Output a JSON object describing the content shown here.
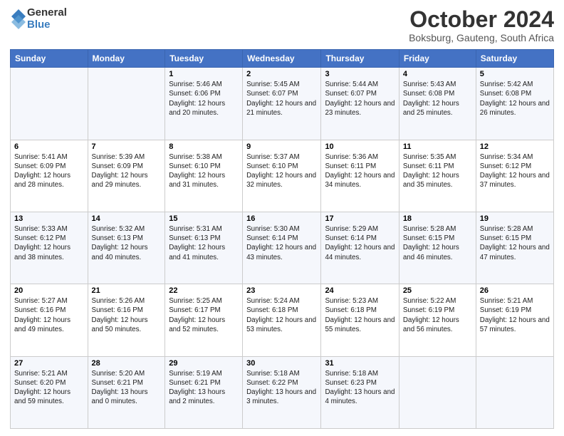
{
  "logo": {
    "general": "General",
    "blue": "Blue"
  },
  "title": "October 2024",
  "subtitle": "Boksburg, Gauteng, South Africa",
  "days_of_week": [
    "Sunday",
    "Monday",
    "Tuesday",
    "Wednesday",
    "Thursday",
    "Friday",
    "Saturday"
  ],
  "weeks": [
    [
      {
        "day": "",
        "sunrise": "",
        "sunset": "",
        "daylight": ""
      },
      {
        "day": "",
        "sunrise": "",
        "sunset": "",
        "daylight": ""
      },
      {
        "day": "1",
        "sunrise": "Sunrise: 5:46 AM",
        "sunset": "Sunset: 6:06 PM",
        "daylight": "Daylight: 12 hours and 20 minutes."
      },
      {
        "day": "2",
        "sunrise": "Sunrise: 5:45 AM",
        "sunset": "Sunset: 6:07 PM",
        "daylight": "Daylight: 12 hours and 21 minutes."
      },
      {
        "day": "3",
        "sunrise": "Sunrise: 5:44 AM",
        "sunset": "Sunset: 6:07 PM",
        "daylight": "Daylight: 12 hours and 23 minutes."
      },
      {
        "day": "4",
        "sunrise": "Sunrise: 5:43 AM",
        "sunset": "Sunset: 6:08 PM",
        "daylight": "Daylight: 12 hours and 25 minutes."
      },
      {
        "day": "5",
        "sunrise": "Sunrise: 5:42 AM",
        "sunset": "Sunset: 6:08 PM",
        "daylight": "Daylight: 12 hours and 26 minutes."
      }
    ],
    [
      {
        "day": "6",
        "sunrise": "Sunrise: 5:41 AM",
        "sunset": "Sunset: 6:09 PM",
        "daylight": "Daylight: 12 hours and 28 minutes."
      },
      {
        "day": "7",
        "sunrise": "Sunrise: 5:39 AM",
        "sunset": "Sunset: 6:09 PM",
        "daylight": "Daylight: 12 hours and 29 minutes."
      },
      {
        "day": "8",
        "sunrise": "Sunrise: 5:38 AM",
        "sunset": "Sunset: 6:10 PM",
        "daylight": "Daylight: 12 hours and 31 minutes."
      },
      {
        "day": "9",
        "sunrise": "Sunrise: 5:37 AM",
        "sunset": "Sunset: 6:10 PM",
        "daylight": "Daylight: 12 hours and 32 minutes."
      },
      {
        "day": "10",
        "sunrise": "Sunrise: 5:36 AM",
        "sunset": "Sunset: 6:11 PM",
        "daylight": "Daylight: 12 hours and 34 minutes."
      },
      {
        "day": "11",
        "sunrise": "Sunrise: 5:35 AM",
        "sunset": "Sunset: 6:11 PM",
        "daylight": "Daylight: 12 hours and 35 minutes."
      },
      {
        "day": "12",
        "sunrise": "Sunrise: 5:34 AM",
        "sunset": "Sunset: 6:12 PM",
        "daylight": "Daylight: 12 hours and 37 minutes."
      }
    ],
    [
      {
        "day": "13",
        "sunrise": "Sunrise: 5:33 AM",
        "sunset": "Sunset: 6:12 PM",
        "daylight": "Daylight: 12 hours and 38 minutes."
      },
      {
        "day": "14",
        "sunrise": "Sunrise: 5:32 AM",
        "sunset": "Sunset: 6:13 PM",
        "daylight": "Daylight: 12 hours and 40 minutes."
      },
      {
        "day": "15",
        "sunrise": "Sunrise: 5:31 AM",
        "sunset": "Sunset: 6:13 PM",
        "daylight": "Daylight: 12 hours and 41 minutes."
      },
      {
        "day": "16",
        "sunrise": "Sunrise: 5:30 AM",
        "sunset": "Sunset: 6:14 PM",
        "daylight": "Daylight: 12 hours and 43 minutes."
      },
      {
        "day": "17",
        "sunrise": "Sunrise: 5:29 AM",
        "sunset": "Sunset: 6:14 PM",
        "daylight": "Daylight: 12 hours and 44 minutes."
      },
      {
        "day": "18",
        "sunrise": "Sunrise: 5:28 AM",
        "sunset": "Sunset: 6:15 PM",
        "daylight": "Daylight: 12 hours and 46 minutes."
      },
      {
        "day": "19",
        "sunrise": "Sunrise: 5:28 AM",
        "sunset": "Sunset: 6:15 PM",
        "daylight": "Daylight: 12 hours and 47 minutes."
      }
    ],
    [
      {
        "day": "20",
        "sunrise": "Sunrise: 5:27 AM",
        "sunset": "Sunset: 6:16 PM",
        "daylight": "Daylight: 12 hours and 49 minutes."
      },
      {
        "day": "21",
        "sunrise": "Sunrise: 5:26 AM",
        "sunset": "Sunset: 6:16 PM",
        "daylight": "Daylight: 12 hours and 50 minutes."
      },
      {
        "day": "22",
        "sunrise": "Sunrise: 5:25 AM",
        "sunset": "Sunset: 6:17 PM",
        "daylight": "Daylight: 12 hours and 52 minutes."
      },
      {
        "day": "23",
        "sunrise": "Sunrise: 5:24 AM",
        "sunset": "Sunset: 6:18 PM",
        "daylight": "Daylight: 12 hours and 53 minutes."
      },
      {
        "day": "24",
        "sunrise": "Sunrise: 5:23 AM",
        "sunset": "Sunset: 6:18 PM",
        "daylight": "Daylight: 12 hours and 55 minutes."
      },
      {
        "day": "25",
        "sunrise": "Sunrise: 5:22 AM",
        "sunset": "Sunset: 6:19 PM",
        "daylight": "Daylight: 12 hours and 56 minutes."
      },
      {
        "day": "26",
        "sunrise": "Sunrise: 5:21 AM",
        "sunset": "Sunset: 6:19 PM",
        "daylight": "Daylight: 12 hours and 57 minutes."
      }
    ],
    [
      {
        "day": "27",
        "sunrise": "Sunrise: 5:21 AM",
        "sunset": "Sunset: 6:20 PM",
        "daylight": "Daylight: 12 hours and 59 minutes."
      },
      {
        "day": "28",
        "sunrise": "Sunrise: 5:20 AM",
        "sunset": "Sunset: 6:21 PM",
        "daylight": "Daylight: 13 hours and 0 minutes."
      },
      {
        "day": "29",
        "sunrise": "Sunrise: 5:19 AM",
        "sunset": "Sunset: 6:21 PM",
        "daylight": "Daylight: 13 hours and 2 minutes."
      },
      {
        "day": "30",
        "sunrise": "Sunrise: 5:18 AM",
        "sunset": "Sunset: 6:22 PM",
        "daylight": "Daylight: 13 hours and 3 minutes."
      },
      {
        "day": "31",
        "sunrise": "Sunrise: 5:18 AM",
        "sunset": "Sunset: 6:23 PM",
        "daylight": "Daylight: 13 hours and 4 minutes."
      },
      {
        "day": "",
        "sunrise": "",
        "sunset": "",
        "daylight": ""
      },
      {
        "day": "",
        "sunrise": "",
        "sunset": "",
        "daylight": ""
      }
    ]
  ]
}
